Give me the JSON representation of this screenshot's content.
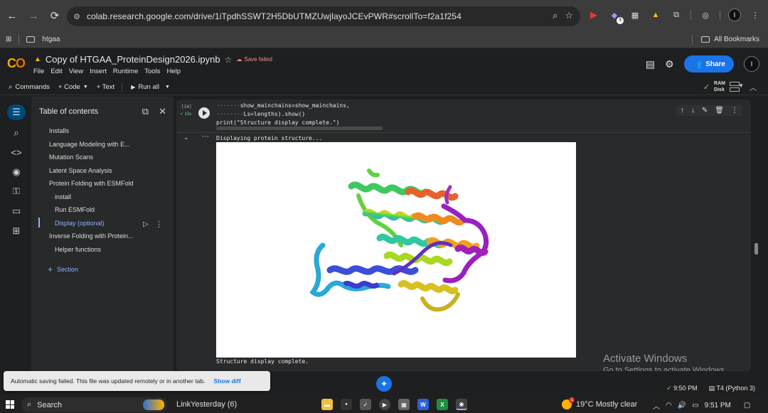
{
  "browser": {
    "url": "colab.research.google.com/drive/1iTpdhSSWT2H5DbUTMZUwjlayoJCEvPWR#scrollTo=f2a1f254",
    "ext_badge": "3",
    "profile_initial": "I"
  },
  "bookmarks": {
    "folder": "htgaa",
    "all": "All Bookmarks"
  },
  "notebook": {
    "title": "Copy of HTGAA_ProteinDesign2026.ipynb",
    "save_status": "Save failed",
    "menu": [
      "File",
      "Edit",
      "View",
      "Insert",
      "Runtime",
      "Tools",
      "Help"
    ],
    "share": "Share",
    "avatar_initial": "I"
  },
  "toolbar": {
    "commands": "Commands",
    "code": "+ Code",
    "text": "+ Text",
    "run_all": "Run all",
    "ram": "RAM",
    "disk": "Disk"
  },
  "toc": {
    "title": "Table of contents",
    "items": [
      {
        "label": "Installs",
        "level": 1
      },
      {
        "label": "Language Modeling with E...",
        "level": 1
      },
      {
        "label": "Mutation Scans",
        "level": 1
      },
      {
        "label": "Latent Space Analysis",
        "level": 1
      },
      {
        "label": "Protein Folding with ESMFold",
        "level": 1
      },
      {
        "label": "install",
        "level": 2
      },
      {
        "label": "Run ESMFold",
        "level": 2
      },
      {
        "label": "Display (optional)",
        "level": 2,
        "active": true
      },
      {
        "label": "Inverse Folding with Protein...",
        "level": 1
      },
      {
        "label": "Helper functions",
        "level": 2
      }
    ],
    "add_section": "Section"
  },
  "cell": {
    "exec_count": "[14]",
    "exec_time": "13s",
    "code_lines": [
      "show_mainchains=show_mainchains,",
      "Ls=lengths).show()",
      "print(\"Structure display complete.\")"
    ],
    "output_before": "Displaying protein structure...",
    "output_after": "Structure display complete."
  },
  "watermark": {
    "line1": "Activate Windows",
    "line2": "Go to Settings to activate Windows."
  },
  "status": {
    "toast": "Automatic saving failed. This file was updated remotely or in another tab.",
    "show_diff": "Show diff",
    "time": "9:50 PM",
    "runtime": "T4 (Python 3)"
  },
  "taskbar": {
    "search": "Search",
    "news": "LinkYesterday (6)",
    "weather": "19°C  Mostly clear",
    "clock": "9:51 PM"
  },
  "colors": {
    "accent": "#1a73e8",
    "colab_orange": "#f9ab00",
    "error": "#f28b82"
  }
}
